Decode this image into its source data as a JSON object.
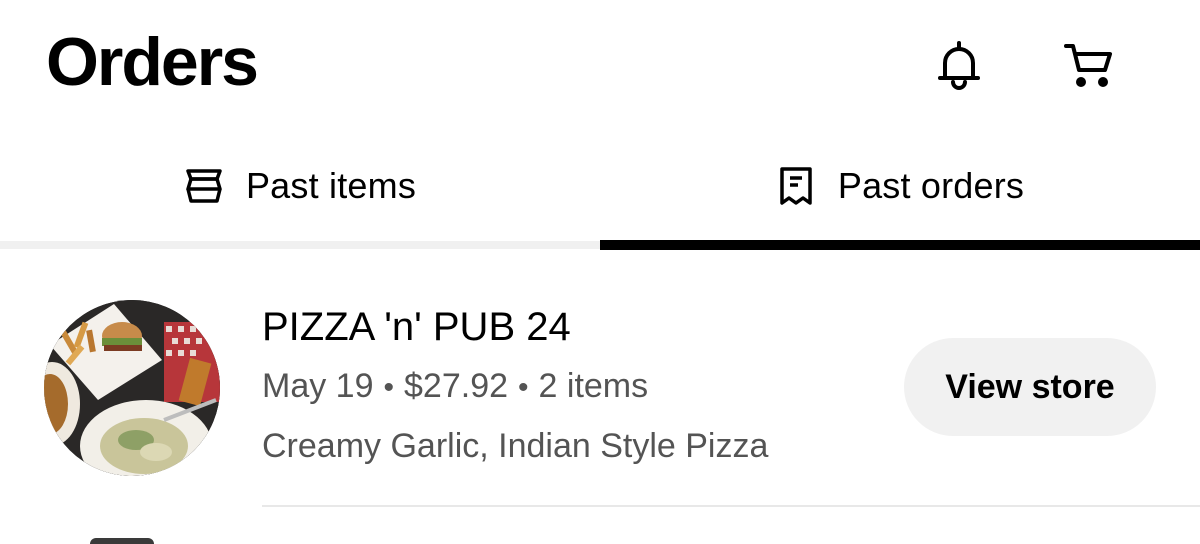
{
  "header": {
    "title": "Orders",
    "bell_icon": "bell-icon",
    "cart_icon": "cart-icon"
  },
  "tabs": [
    {
      "label": "Past items",
      "icon": "bag-icon",
      "active": false
    },
    {
      "label": "Past orders",
      "icon": "receipt-icon",
      "active": true
    }
  ],
  "orders": [
    {
      "store": "PIZZA 'n' PUB 24",
      "date": "May 19",
      "separator": "•",
      "total": "$27.92",
      "items": "2 items",
      "description": "Creamy Garlic, Indian Style Pizza",
      "button_label": "View store",
      "thumbnail": "food-photo"
    }
  ],
  "colors": {
    "accent": "#000000",
    "muted_text": "#545454",
    "button_bg": "#f1f1f1",
    "tab_track": "#f0f0f0"
  }
}
